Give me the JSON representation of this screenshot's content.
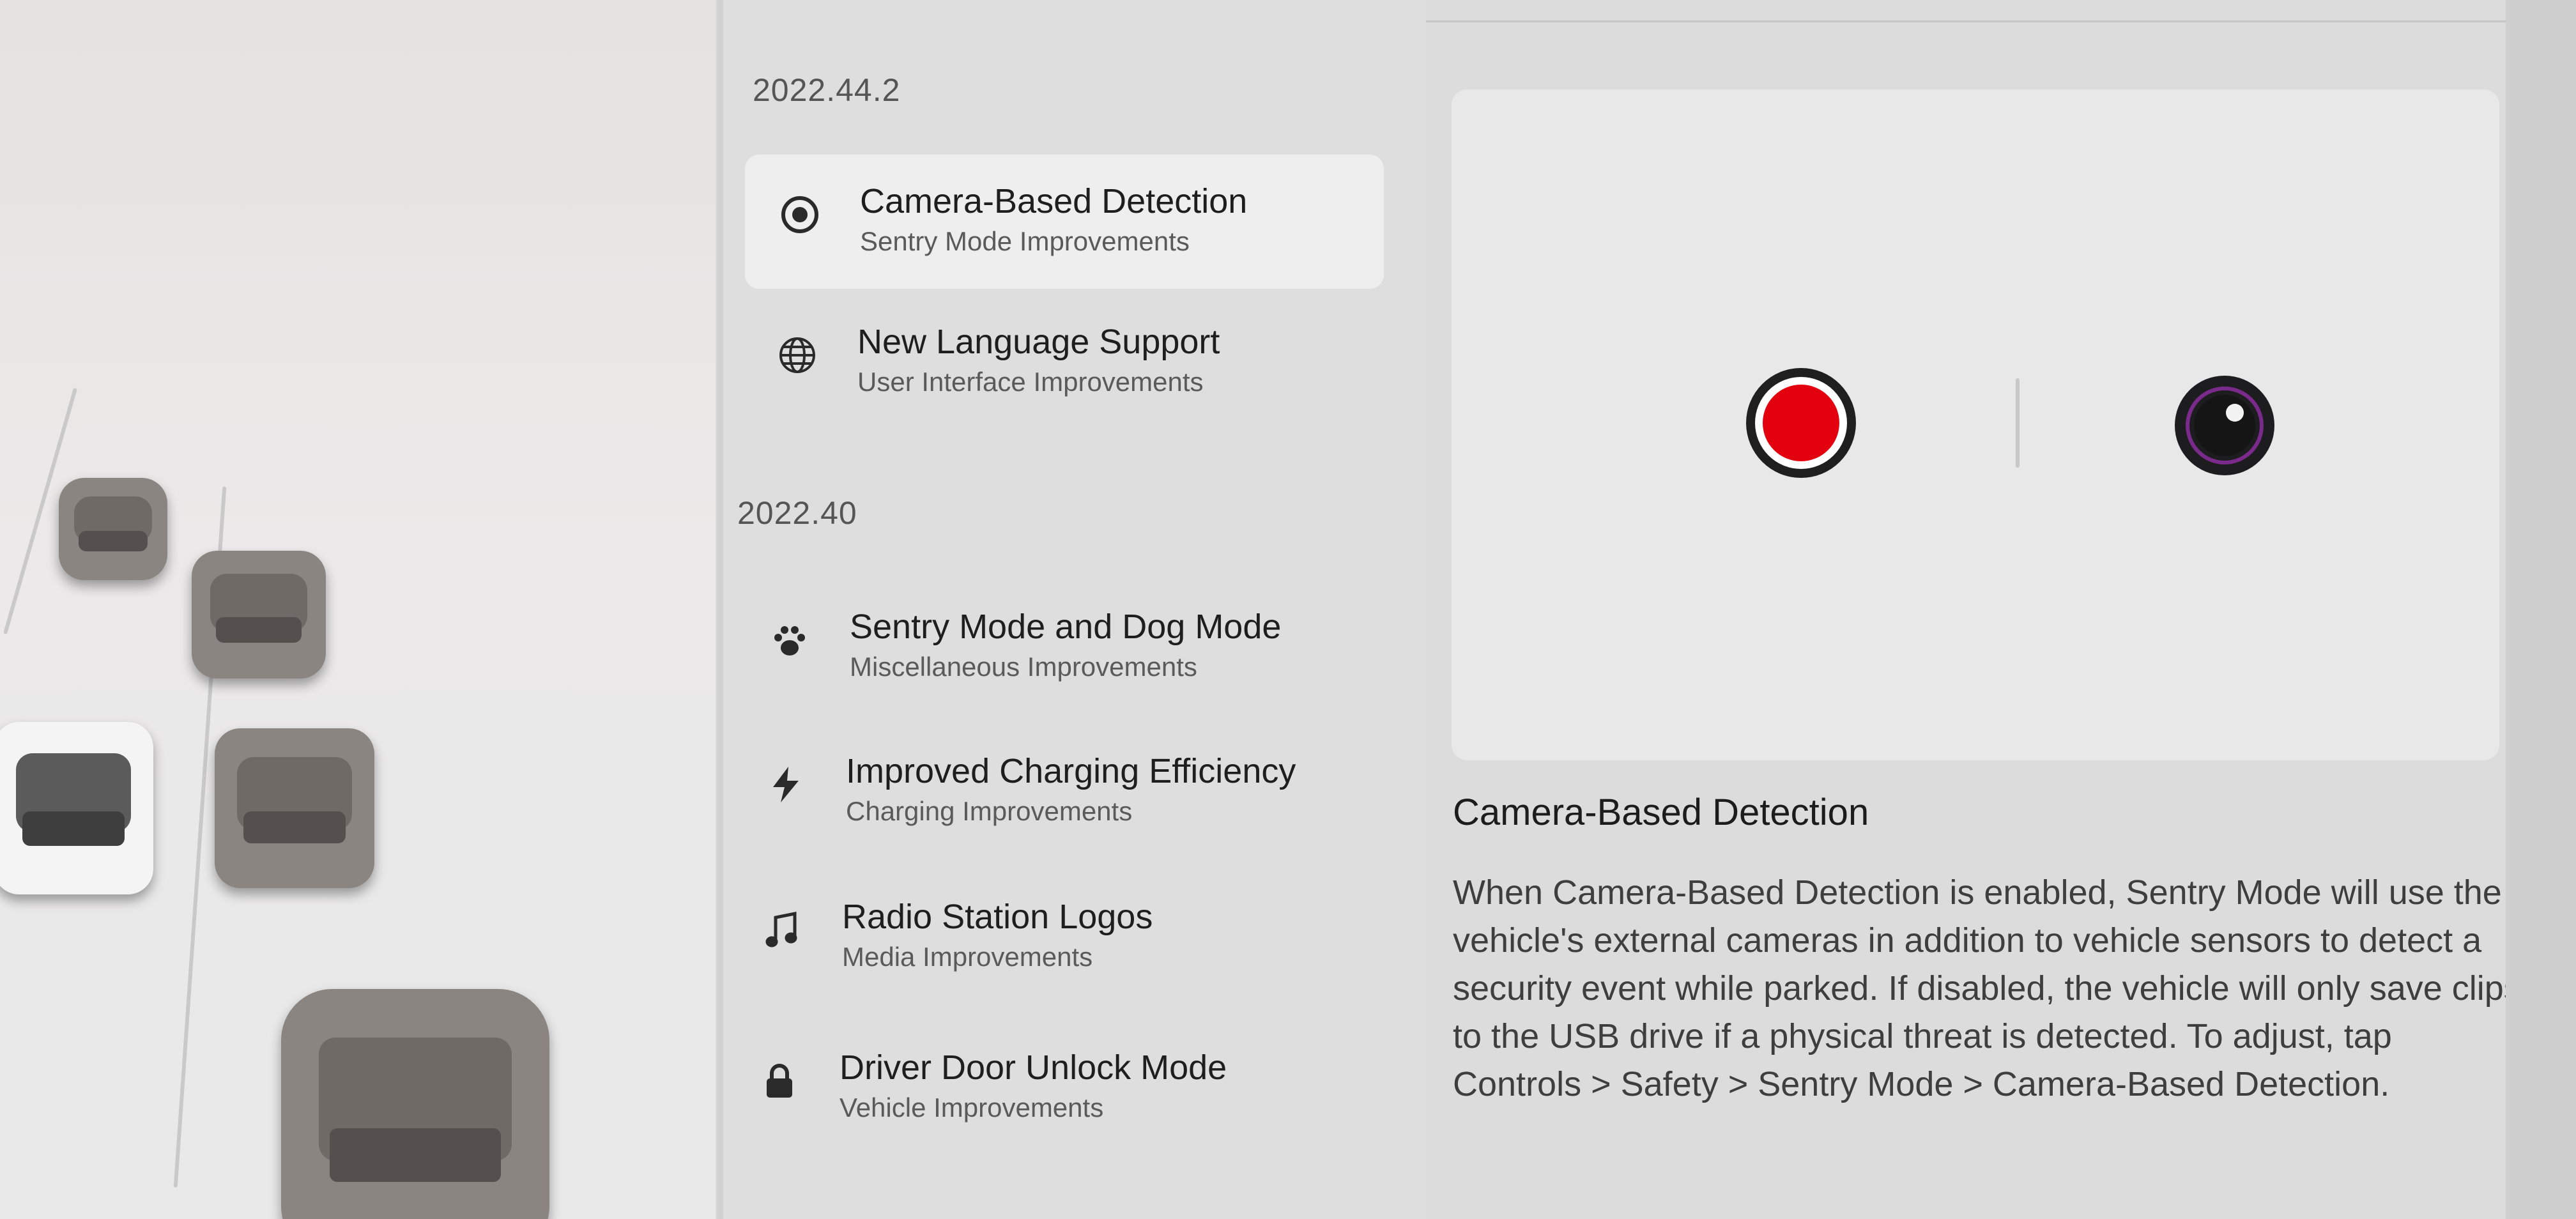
{
  "updates": {
    "groups": [
      {
        "version": "2022.44.2",
        "items": [
          {
            "title": "Camera-Based Detection",
            "subtitle": "Sentry Mode Improvements",
            "icon": "camera-icon",
            "selected": true
          },
          {
            "title": "New Language Support",
            "subtitle": "User Interface Improvements",
            "icon": "globe-icon",
            "selected": false
          }
        ]
      },
      {
        "version": "2022.40",
        "items": [
          {
            "title": "Sentry Mode and Dog Mode",
            "subtitle": "Miscellaneous Improvements",
            "icon": "paw-icon",
            "selected": false
          },
          {
            "title": "Improved Charging Efficiency",
            "subtitle": "Charging Improvements",
            "icon": "lightning-icon",
            "selected": false
          },
          {
            "title": "Radio Station Logos",
            "subtitle": "Media Improvements",
            "icon": "music-note-icon",
            "selected": false
          },
          {
            "title": "Driver Door Unlock Mode",
            "subtitle": "Vehicle Improvements",
            "icon": "lock-icon",
            "selected": false
          }
        ]
      }
    ]
  },
  "detail": {
    "title": "Camera-Based Detection",
    "body": "When Camera-Based Detection is enabled, Sentry Mode will use the vehicle's external cameras in addition to vehicle sensors to detect a security event while parked. If disabled, the vehicle will only save clips to the USB drive if a physical threat is detected. To adjust, tap Controls > Safety > Sentry Mode > Camera-Based Detection.",
    "preview_icons": [
      "record-icon",
      "camera-lens-icon"
    ]
  },
  "colors": {
    "record_red": "#e3000f",
    "camera_ring": "#7a2a8a",
    "selected_bg": "#eeeeee"
  }
}
